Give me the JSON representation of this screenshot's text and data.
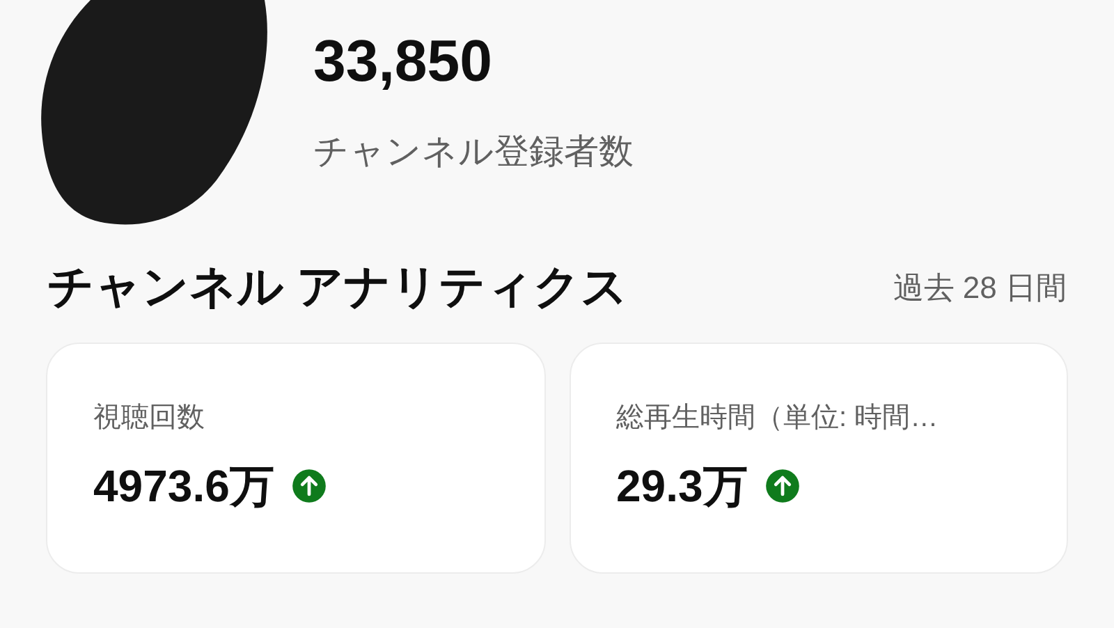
{
  "channel": {
    "subscriber_count": "33,850",
    "subscriber_label": "チャンネル登録者数"
  },
  "analytics": {
    "title": "チャンネル アナリティクス",
    "period": "過去 28 日間",
    "cards": [
      {
        "label": "視聴回数",
        "value": "4973.6万",
        "rising": true
      },
      {
        "label": "総再生時間（単位: 時間…",
        "value": "29.3万",
        "rising": true
      }
    ]
  }
}
